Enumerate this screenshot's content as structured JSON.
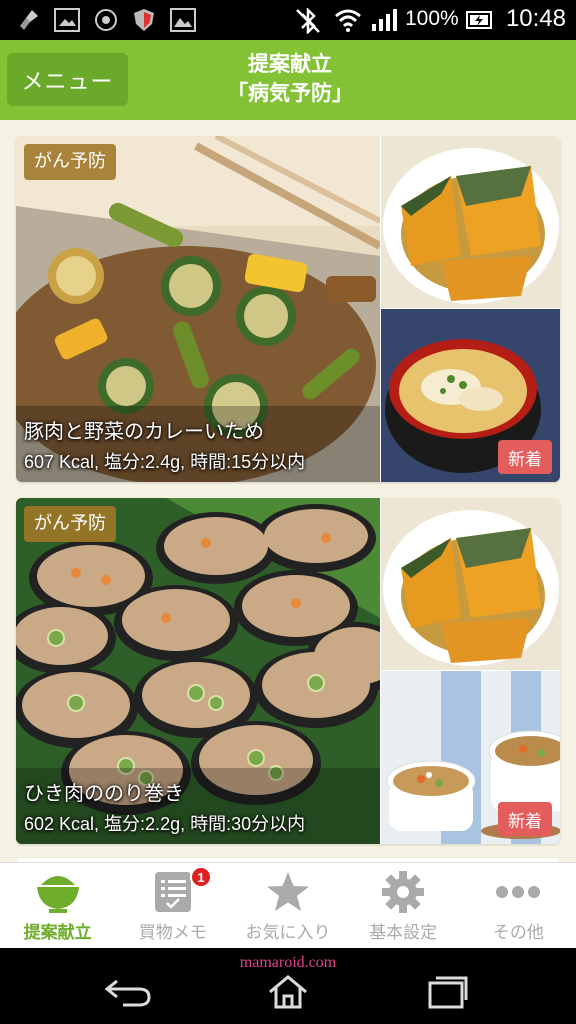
{
  "status_bar": {
    "battery_text": "100%",
    "time": "10:48",
    "icons": [
      "broom-icon",
      "image-icon",
      "shutter-icon",
      "shield-icon",
      "gallery-icon",
      "bluetooth-off-icon",
      "wifi-icon",
      "signal-icon",
      "battery-icon"
    ]
  },
  "header": {
    "menu_label": "メニュー",
    "title_line1": "提案献立",
    "title_line2": "「病気予防」"
  },
  "cards": [
    {
      "category": "がん予防",
      "name": "豚肉と野菜のカレーいため",
      "stats": "607 Kcal, 塩分:2.4g, 時間:15分以内",
      "new_label": "新着"
    },
    {
      "category": "がん予防",
      "name": "ひき肉ののり巻き",
      "stats": "602 Kcal, 塩分:2.2g, 時間:30分以内",
      "new_label": "新着"
    }
  ],
  "tabs": [
    {
      "label": "提案献立",
      "icon": "rice-bowl-icon",
      "active": true
    },
    {
      "label": "買物メモ",
      "icon": "memo-icon",
      "active": false,
      "badge": "1"
    },
    {
      "label": "お気に入り",
      "icon": "star-icon",
      "active": false
    },
    {
      "label": "基本設定",
      "icon": "gear-icon",
      "active": false
    },
    {
      "label": "その他",
      "icon": "more-icon",
      "active": false
    }
  ],
  "watermark": "mamaroid.com",
  "colors": {
    "header_green": "#82c234",
    "menu_button": "#6aa92a",
    "active_tab": "#6fae2c",
    "new_badge": "#e45d5d",
    "category_badge": "#a07828"
  }
}
